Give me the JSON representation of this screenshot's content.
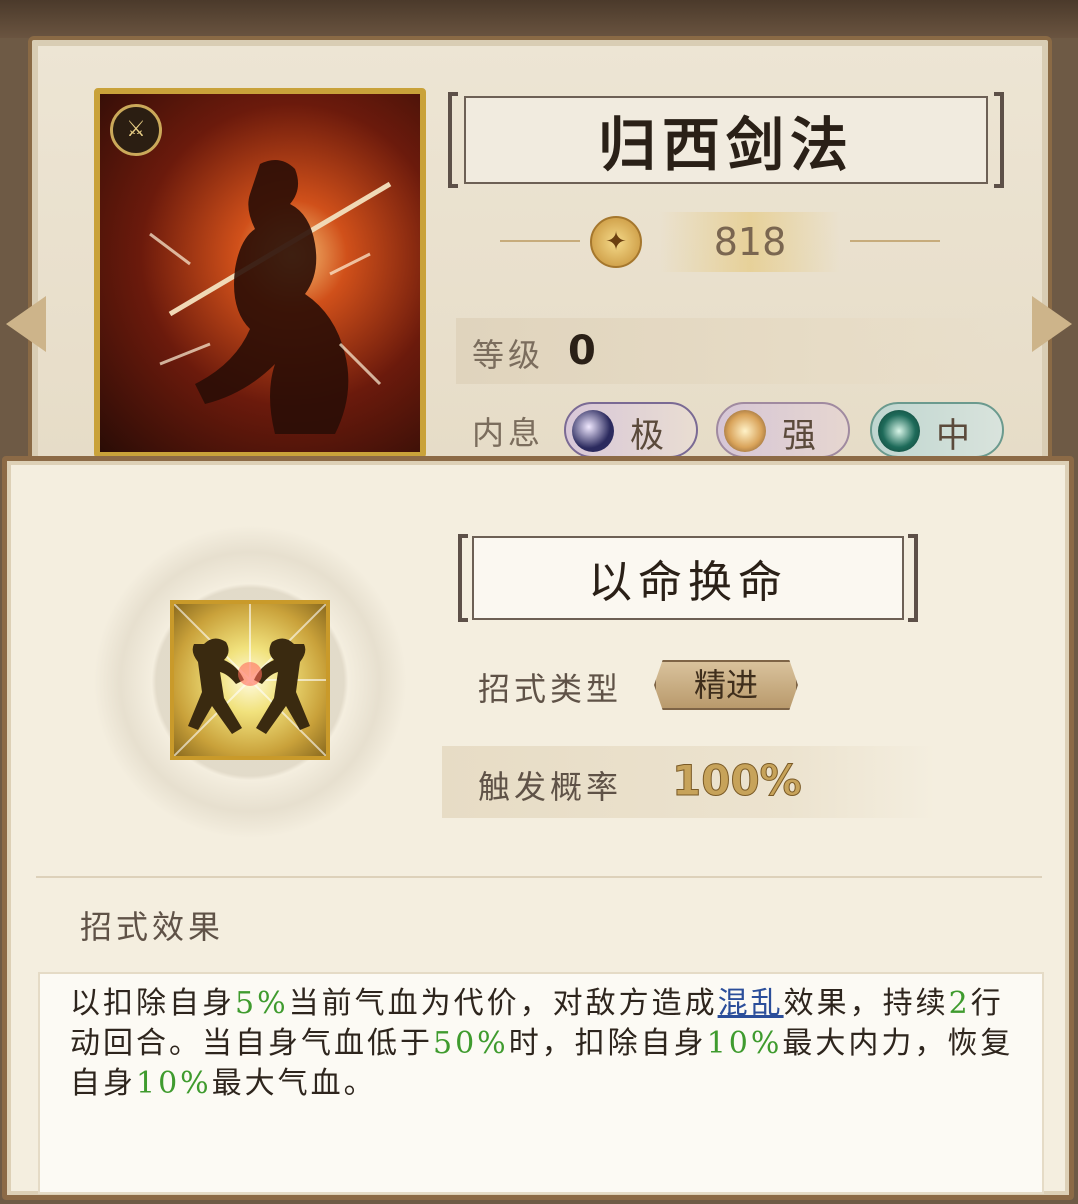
{
  "card": {
    "name": "归西剑法",
    "power": "818",
    "level_label": "等级",
    "level_value": "0",
    "neixi_label": "内息",
    "neixi": [
      {
        "label": "极",
        "color": "#2b2a5e"
      },
      {
        "label": "强",
        "color": "#d9a35a"
      },
      {
        "label": "中",
        "color": "#1e6b5a"
      }
    ]
  },
  "skill": {
    "name": "以命换命",
    "type_label": "招式类型",
    "type_value": "精进",
    "rate_label": "触发概率",
    "rate_value": "100%",
    "effect_heading": "招式效果",
    "effect_segments": [
      {
        "text": "以扣除自身",
        "style": "normal"
      },
      {
        "text": "5%",
        "style": "green"
      },
      {
        "text": "当前气血为代价，对敌方造成",
        "style": "normal"
      },
      {
        "text": "混乱",
        "style": "link"
      },
      {
        "text": "效果，持续",
        "style": "normal"
      },
      {
        "text": "2",
        "style": "green"
      },
      {
        "text": "行动回合。当自身气血低于",
        "style": "normal"
      },
      {
        "text": "50%",
        "style": "green"
      },
      {
        "text": "时，扣除自身",
        "style": "normal"
      },
      {
        "text": "10%",
        "style": "green"
      },
      {
        "text": "最大内力，恢复自身",
        "style": "normal"
      },
      {
        "text": "10%",
        "style": "green"
      },
      {
        "text": "最大气血。",
        "style": "normal"
      }
    ]
  },
  "colors": {
    "highlight_green": "#3f9b2e",
    "link_blue": "#2b4e9a",
    "frame_brown": "#8c6a46"
  }
}
